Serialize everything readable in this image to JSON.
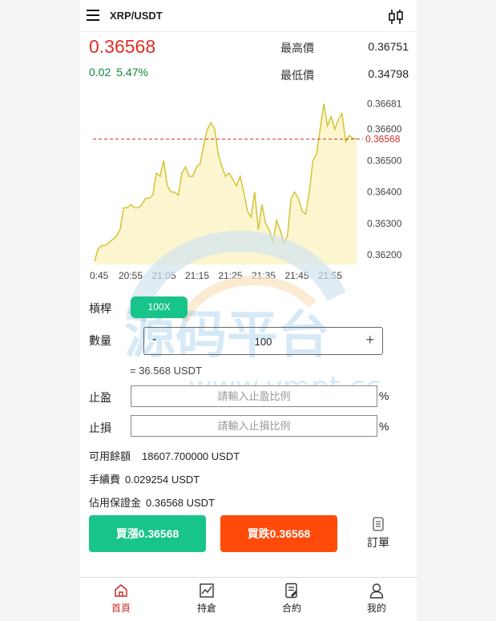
{
  "header": {
    "pair": "XRP/USDT",
    "menu_icon": "menu-icon",
    "kline_icon": "candlestick-icon"
  },
  "quote": {
    "price": "0.36568",
    "change_abs": "0.02",
    "change_pct": "5.47%",
    "high_label": "最高價",
    "high_value": "0.36751",
    "low_label": "最低價",
    "low_value": "0.34798",
    "price_color": "#e02e24",
    "change_color": "#0a8a3a"
  },
  "chart_data": {
    "type": "area",
    "x_tick_labels": [
      "0:45",
      "20:55",
      "21:05",
      "21:15",
      "21:25",
      "21:35",
      "21:45",
      "21:55"
    ],
    "y_tick_labels": [
      "0.36681",
      "0.36600",
      "0.36500",
      "0.36400",
      "0.36300",
      "0.36200"
    ],
    "y_ticks": [
      0.36681,
      0.366,
      0.365,
      0.364,
      0.363,
      0.362
    ],
    "current_price": 0.36568,
    "current_label": "0.36568",
    "ylim": [
      0.3617,
      0.3673
    ],
    "line_color": "#d4c437",
    "fill_color": "#fbf6cf",
    "marker_color": "#c9302c",
    "values": [
      0.3618,
      0.3622,
      0.3623,
      0.3623,
      0.3624,
      0.3625,
      0.3626,
      0.3628,
      0.3635,
      0.3635,
      0.3636,
      0.3635,
      0.3635,
      0.3636,
      0.3638,
      0.3638,
      0.3639,
      0.3646,
      0.3645,
      0.365,
      0.3642,
      0.364,
      0.364,
      0.3639,
      0.3646,
      0.3648,
      0.3645,
      0.3645,
      0.3648,
      0.3649,
      0.3655,
      0.366,
      0.3662,
      0.366,
      0.3652,
      0.3648,
      0.3645,
      0.3646,
      0.3644,
      0.3642,
      0.3645,
      0.364,
      0.3634,
      0.3632,
      0.364,
      0.3628,
      0.3636,
      0.363,
      0.3628,
      0.3624,
      0.3631,
      0.3628,
      0.3624,
      0.3626,
      0.3638,
      0.364,
      0.3638,
      0.3634,
      0.3633,
      0.364,
      0.365,
      0.3652,
      0.366,
      0.3668,
      0.3661,
      0.3664,
      0.366,
      0.3663,
      0.3665,
      0.3656,
      0.3658,
      0.3657,
      0.3657
    ]
  },
  "form": {
    "leverage_label": "槓桿",
    "leverage_value": "100X",
    "quantity_label": "數量",
    "quantity_minus": "-",
    "quantity_value": "100",
    "quantity_plus": "+",
    "equivalent": "= 36.568 USDT",
    "take_profit_label": "止盈",
    "take_profit_placeholder": "請輸入止盈比例",
    "stop_loss_label": "止損",
    "stop_loss_placeholder": "請輸入止損比例",
    "percent_sign": "%",
    "available_label": "可用餘額",
    "available_value": "18607.700000 USDT",
    "fee_label": "手續費",
    "fee_value": "0.029254 USDT",
    "margin_label": "佔用保證金",
    "margin_value": "0.36568 USDT"
  },
  "actions": {
    "buy_label": "買漲0.36568",
    "sell_label": "買跌0.36568",
    "orders_label": "訂單",
    "buy_color": "#19c48a",
    "sell_color": "#ff4a0a"
  },
  "nav": {
    "items": [
      {
        "label": "首頁",
        "icon": "home-icon",
        "active": true
      },
      {
        "label": "持倉",
        "icon": "chart-icon",
        "active": false
      },
      {
        "label": "合約",
        "icon": "contract-icon",
        "active": false
      },
      {
        "label": "我的",
        "icon": "user-icon",
        "active": false
      }
    ],
    "active_color": "#c9302c"
  },
  "watermark": {
    "text": "源码平台",
    "url": "www.ympt.cc"
  }
}
